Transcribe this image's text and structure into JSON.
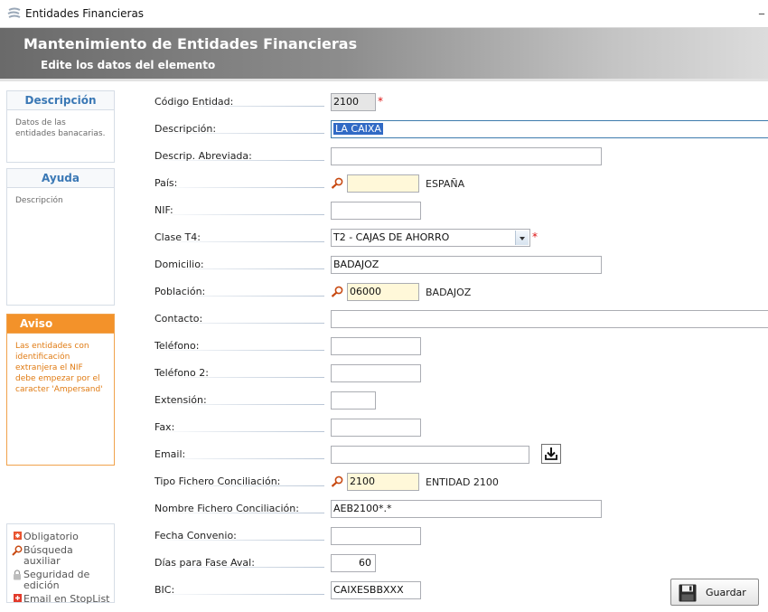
{
  "window": {
    "title": "Entidades Financieras",
    "minimize": "_"
  },
  "header": {
    "title": "Mantenimiento de Entidades Financieras",
    "subtitle": "Edite los datos del elemento"
  },
  "sidebar": {
    "descripcion": {
      "title": "Descripción",
      "body": "Datos de las entidades banacarias."
    },
    "ayuda": {
      "title": "Ayuda",
      "body": "Descripción"
    },
    "aviso": {
      "title": "Aviso",
      "body": "Las entidades con identificación extranjera el NIF debe empezar por el caracter 'Ampersand'"
    },
    "legend": {
      "obligatorio": "Obligatorio",
      "busqueda": "Búsqueda auxiliar",
      "seguridad": "Seguridad de edición",
      "email_stoplist": "Email en StopList"
    }
  },
  "form": {
    "codigo": {
      "label": "Código Entidad:",
      "value": "2100"
    },
    "descripcion": {
      "label": "Descripción:",
      "value": "LA CAIXA"
    },
    "descrip_abreviada": {
      "label": "Descrip. Abreviada:",
      "value": ""
    },
    "pais": {
      "label": "País:",
      "value": "",
      "aux": "ESPAÑA"
    },
    "nif": {
      "label": "NIF:",
      "value": ""
    },
    "clase_t4": {
      "label": "Clase T4:",
      "value": "T2 - CAJAS DE AHORRO"
    },
    "domicilio": {
      "label": "Domicilio:",
      "value": "BADAJOZ"
    },
    "poblacion": {
      "label": "Población:",
      "value": "06000",
      "aux": "BADAJOZ"
    },
    "contacto": {
      "label": "Contacto:",
      "value": ""
    },
    "telefono": {
      "label": "Teléfono:",
      "value": ""
    },
    "telefono2": {
      "label": "Teléfono 2:",
      "value": ""
    },
    "extension": {
      "label": "Extensión:",
      "value": ""
    },
    "fax": {
      "label": "Fax:",
      "value": ""
    },
    "email": {
      "label": "Email:",
      "value": ""
    },
    "tipo_fichero": {
      "label": "Tipo Fichero Conciliación:",
      "value": "2100",
      "aux": "ENTIDAD 2100"
    },
    "nombre_fichero": {
      "label": "Nombre Fichero Conciliación:",
      "value": "AEB2100*.*"
    },
    "fecha_convenio": {
      "label": "Fecha Convenio:",
      "value": ""
    },
    "dias_fase_aval": {
      "label": "Días para Fase Aval:",
      "value": "60"
    },
    "bic": {
      "label": "BIC:",
      "value": "CAIXESBBXXX"
    },
    "required_mark": "*"
  },
  "actions": {
    "save_label": "Guardar"
  },
  "icons": {
    "app": "app-logo-icon",
    "search": "magnifier-icon",
    "download": "download-icon",
    "save": "floppy-disk-icon",
    "lock": "lock-icon",
    "required": "required-icon",
    "stoplist": "stoplist-icon"
  },
  "colors": {
    "accent": "#3a78b5",
    "warning": "#f3922a",
    "lookup_bg": "#fff8d9",
    "required": "#dd1111"
  }
}
